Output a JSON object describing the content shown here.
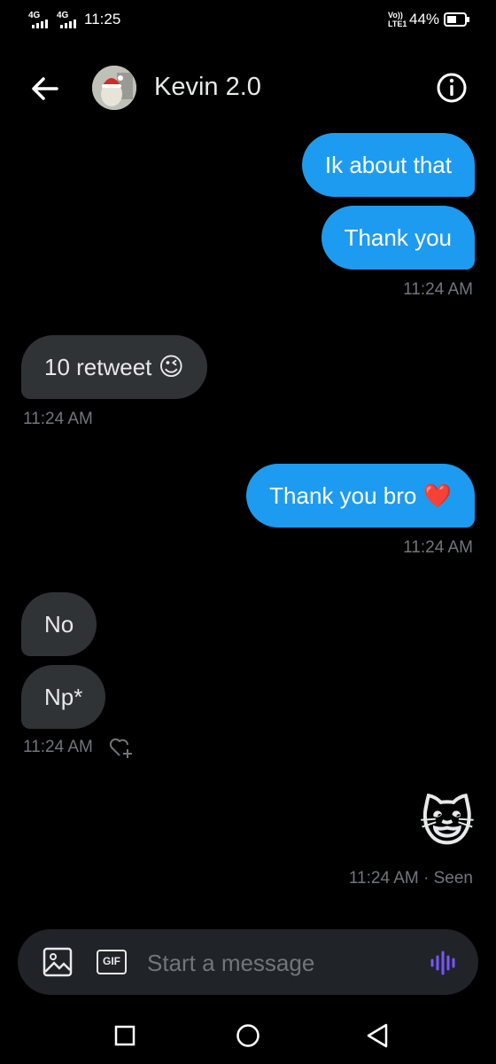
{
  "status_bar": {
    "net1": "4G",
    "net2": "4G",
    "time": "11:25",
    "volte": "Vo))\nLTE1",
    "battery": "44%"
  },
  "header": {
    "title": "Kevin 2.0"
  },
  "messages": [
    {
      "side": "out",
      "text": "Ik about that"
    },
    {
      "side": "out",
      "text": "Thank you",
      "time": "11:24 AM"
    },
    {
      "side": "in",
      "text": "10 retweet",
      "emoji": "😉",
      "time": "11:24 AM"
    },
    {
      "side": "out",
      "text": "Thank you bro",
      "emoji": "❤️",
      "time": "11:24 AM"
    },
    {
      "side": "in",
      "text": "No"
    },
    {
      "side": "in",
      "text": "Np*",
      "time": "11:24 AM"
    },
    {
      "side": "out",
      "emoji": "😺",
      "time": "11:24 AM · Seen"
    }
  ],
  "composer": {
    "placeholder": "Start a message",
    "gif_label": "GIF"
  },
  "colors": {
    "accent": "#1d9bf0",
    "incoming_bubble": "#2f3336",
    "voice_icon": "#7856ff"
  }
}
